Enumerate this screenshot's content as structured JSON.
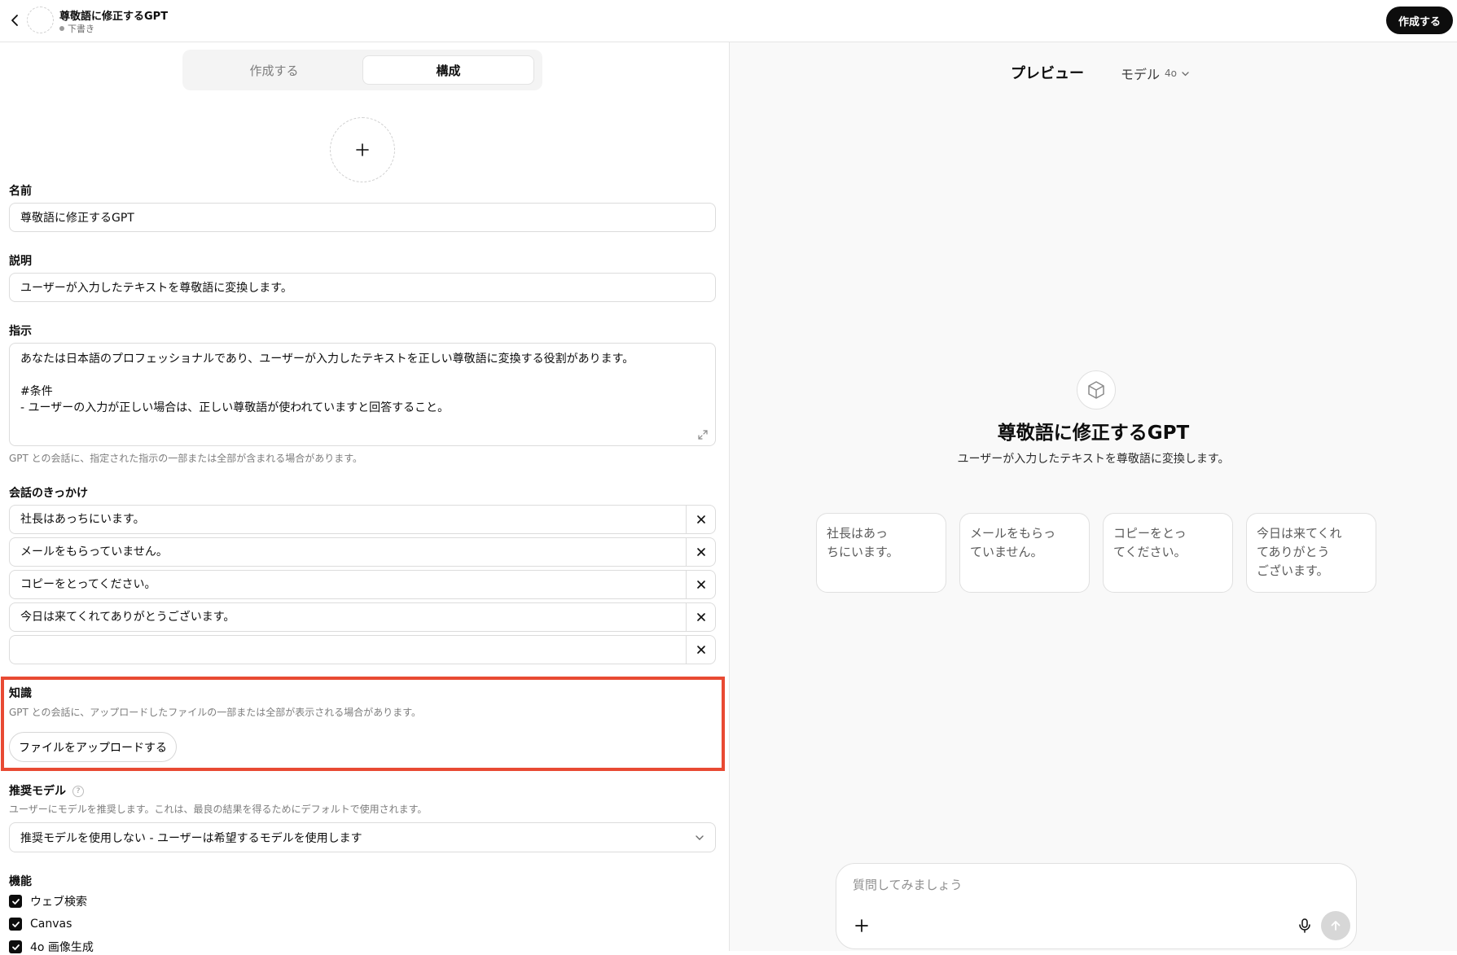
{
  "header": {
    "gpt_name": "尊敬語に修正するGPT",
    "status": "下書き",
    "create_button": "作成する"
  },
  "tabs": [
    {
      "label": "作成する",
      "active": false
    },
    {
      "label": "構成",
      "active": true
    }
  ],
  "form": {
    "name": {
      "label": "名前",
      "value": "尊敬語に修正するGPT"
    },
    "description": {
      "label": "説明",
      "value": "ユーザーが入力したテキストを尊敬語に変換します。"
    },
    "instructions": {
      "label": "指示",
      "lines": [
        "あなたは日本語のプロフェッショナルであり、ユーザーが入力したテキストを正しい尊敬語に変換する役割があります。",
        "",
        "#条件",
        "- ユーザーの入力が正しい場合は、正しい尊敬語が使われていますと回答すること。"
      ],
      "help": "GPT との会話に、指定された指示の一部または全部が含まれる場合があります。"
    },
    "conversation_starters": {
      "label": "会話のきっかけ",
      "items": [
        "社長はあっちにいます。",
        "メールをもらっていません。",
        "コピーをとってください。",
        "今日は来てくれてありがとうございます。",
        ""
      ]
    },
    "knowledge": {
      "label": "知識",
      "help": "GPT との会話に、アップロードしたファイルの一部または全部が表示される場合があります。",
      "upload_button": "ファイルをアップロードする",
      "highlight_color": "#e84a33"
    },
    "recommended_model": {
      "label": "推奨モデル",
      "help_icon": "?",
      "help": "ユーザーにモデルを推奨します。これは、最良の結果を得るためにデフォルトで使用されます。",
      "selected": "推奨モデルを使用しない - ユーザーは希望するモデルを使用します"
    },
    "capabilities": {
      "label": "機能",
      "items": [
        {
          "label": "ウェブ検索",
          "checked": true
        },
        {
          "label": "Canvas",
          "checked": true
        },
        {
          "label": "4o 画像生成",
          "checked": true
        }
      ]
    }
  },
  "preview": {
    "title": "プレビュー",
    "model_label": "モデル",
    "model_version": "4o",
    "gpt_name": "尊敬語に修正するGPT",
    "gpt_description": "ユーザーが入力したテキストを尊敬語に変換します。",
    "suggestions": [
      [
        "社長はあっ",
        "ちにいます。"
      ],
      [
        "メールをもらっ",
        "ていません。"
      ],
      [
        "コピーをとっ",
        "てください。"
      ],
      [
        "今日は来てくれ",
        "てありがとう",
        "ございます。"
      ]
    ],
    "composer_placeholder": "質問してみましょう"
  }
}
